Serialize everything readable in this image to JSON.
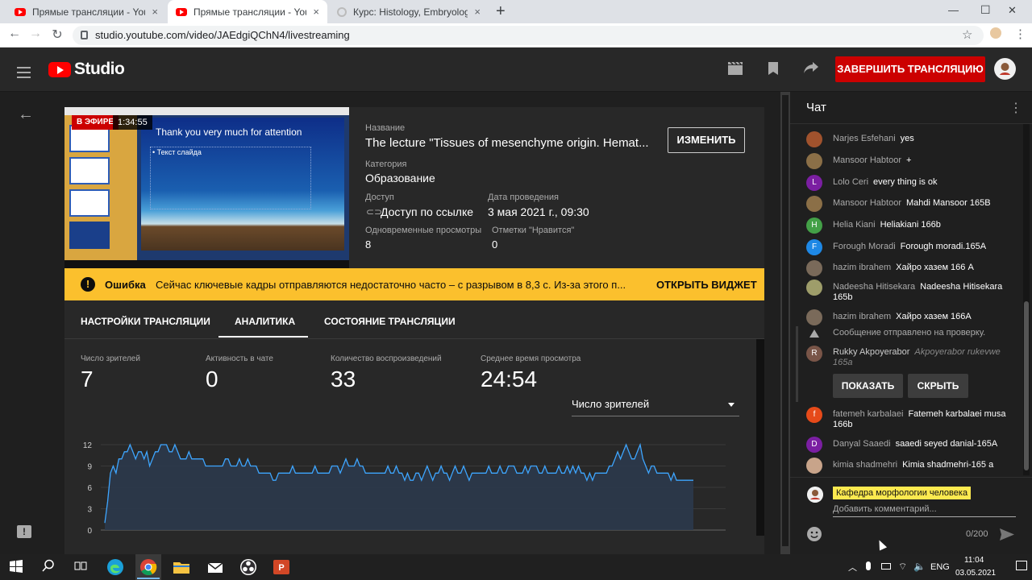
{
  "browser": {
    "tabs": [
      {
        "title": "Прямые трансляции - YouTube",
        "close": "×"
      },
      {
        "title": "Прямые трансляции - YouTube",
        "close": "×"
      },
      {
        "title": "Курс: Histology, Embryology, Cyt",
        "close": "×"
      }
    ],
    "new_tab": "+",
    "url": "studio.youtube.com/video/JAEdgiQChN4/livestreaming",
    "window": {
      "minimize": "—",
      "maximize": "☐",
      "close": "✕"
    }
  },
  "header": {
    "logo_text": "Studio",
    "end_stream": "ЗАВЕРШИТЬ ТРАНСЛЯЦИЮ"
  },
  "preview": {
    "live_badge": "В ЭФИРЕ",
    "timecode": "1:34:55",
    "slide_title": "Thank you very much for attention",
    "slide_bullet": "• Текст слайда"
  },
  "stream_info": {
    "name_label": "Название",
    "name_value": "The lecture \"Tissues of mesenchyme origin. Hemat...",
    "edit_button": "ИЗМЕНИТЬ",
    "category_label": "Категория",
    "category_value": "Образование",
    "access_label": "Доступ",
    "access_value": "Доступ по ссылке",
    "date_label": "Дата проведения",
    "date_value": "3 мая 2021 г., 09:30",
    "concurrent_label": "Одновременные просмотры",
    "concurrent_value": "8",
    "likes_label": "Отметки \"Нравится\"",
    "likes_value": "0"
  },
  "error_bar": {
    "title": "Ошибка",
    "message": "Сейчас ключевые кадры отправляются недостаточно часто – с разрывом в 8,3 с. Из-за этого п...",
    "action": "ОТКРЫТЬ ВИДЖЕТ",
    "color": "#fbc02d"
  },
  "tabs": [
    {
      "label": "НАСТРОЙКИ ТРАНСЛЯЦИИ"
    },
    {
      "label": "АНАЛИТИКА",
      "active": true
    },
    {
      "label": "СОСТОЯНИЕ ТРАНСЛЯЦИИ"
    }
  ],
  "analytics": {
    "metrics": [
      {
        "label": "Число зрителей",
        "value": "7"
      },
      {
        "label": "Активность в чате",
        "value": "0"
      },
      {
        "label": "Количество воспроизведений",
        "value": "33"
      },
      {
        "label": "Среднее время просмотра",
        "value": "24:54"
      }
    ],
    "dropdown": "Число зрителей"
  },
  "chart_data": {
    "type": "area",
    "ylim": [
      0,
      12
    ],
    "yticks": [
      "12",
      "9",
      "6",
      "3",
      "0"
    ],
    "values": [
      1,
      4,
      8,
      9,
      8,
      10,
      10,
      11,
      11,
      12,
      11,
      10,
      11,
      11,
      10,
      11,
      9,
      10,
      11,
      11,
      12,
      12,
      12,
      11,
      11,
      12,
      11,
      10,
      10,
      10,
      11,
      10,
      10,
      10,
      10,
      10,
      9,
      9,
      9,
      9,
      9,
      9,
      9,
      10,
      10,
      9,
      9,
      9,
      10,
      9,
      9,
      10,
      9,
      9,
      9,
      8,
      8,
      8,
      8,
      8,
      7,
      7,
      8,
      8,
      8,
      8,
      8,
      9,
      8,
      8,
      8,
      8,
      8,
      8,
      8,
      9,
      8,
      8,
      8,
      8,
      8,
      9,
      9,
      9,
      8,
      9,
      10,
      9,
      9,
      9,
      10,
      9,
      9,
      8,
      8,
      8,
      8,
      8,
      8,
      8,
      8,
      9,
      8,
      8,
      9,
      8,
      8,
      7,
      8,
      7,
      7,
      8,
      8,
      7,
      8,
      9,
      8,
      7,
      8,
      8,
      9,
      8,
      8,
      7,
      8,
      9,
      8,
      8,
      9,
      8,
      7,
      8,
      8,
      8,
      8,
      8,
      8,
      9,
      8,
      8,
      8,
      9,
      8,
      8,
      9,
      9,
      9,
      8,
      8,
      8,
      9,
      8,
      9,
      9,
      9,
      8,
      8,
      9,
      8,
      8,
      8,
      8,
      9,
      8,
      8,
      9,
      8,
      9,
      8,
      9,
      8,
      8,
      7,
      8,
      7,
      8,
      8,
      8,
      8,
      8,
      9,
      9,
      10,
      11,
      10,
      11,
      12,
      11,
      10,
      10,
      11,
      12,
      10,
      9,
      8,
      9,
      9,
      8,
      8,
      8,
      8,
      8,
      7,
      8,
      7,
      7,
      7,
      7,
      7,
      7,
      7
    ],
    "color": "#3ea6ff"
  },
  "chat": {
    "title": "Чат",
    "messages": [
      {
        "initial": "",
        "avatar_color": "#a0522d",
        "name": "Narjes Esfehani",
        "text": "yes"
      },
      {
        "initial": "",
        "avatar_color": "#8b6f47",
        "name": "Mansoor Habtoor",
        "text": "+"
      },
      {
        "initial": "L",
        "avatar_color": "#7b1fa2",
        "name": "Lolo Ceri",
        "text": "every thing is ok"
      },
      {
        "initial": "",
        "avatar_color": "#8b6f47",
        "name": "Mansoor Habtoor",
        "text": "Mahdi Mansoor 165B"
      },
      {
        "initial": "H",
        "avatar_color": "#43a047",
        "name": "Helia Kiani",
        "text": "Heliakiani 166b"
      },
      {
        "initial": "F",
        "avatar_color": "#1e88e5",
        "name": "Forough Moradi",
        "text": "Forough moradi.165A"
      },
      {
        "initial": "",
        "avatar_color": "#7a6a5a",
        "name": "hazim ibrahem",
        "text": "Хайро хазем 166 А"
      },
      {
        "initial": "",
        "avatar_color": "#9e9d6a",
        "name": "Nadeesha Hitisekara",
        "text": "Nadeesha Hitisekara 165b"
      },
      {
        "initial": "",
        "avatar_color": "#7a6a5a",
        "name": "hazim ibrahem",
        "text": "Хайро хазем 166А"
      }
    ],
    "review_note": "Сообщение отправлено на проверку.",
    "held": {
      "initial": "R",
      "avatar_color": "#795548",
      "name": "Rukky Akpoyerabor",
      "text": "Akpoyerabor rukevwe 165a",
      "show": "ПОКАЗАТЬ",
      "hide": "СКРЫТЬ"
    },
    "messages2": [
      {
        "initial": "f",
        "avatar_color": "#e64a19",
        "name": "fatemeh karbalaei",
        "text": "Fatemeh karbalaei musa 166b"
      },
      {
        "initial": "D",
        "avatar_color": "#7b1fa2",
        "name": "Danyal Saaedi",
        "text": "saaedi seyed danial-165A"
      },
      {
        "initial": "",
        "avatar_color": "#c8a48a",
        "name": "kimia shadmehri",
        "text": "Kimia shadmehri-165 a"
      }
    ],
    "composer": {
      "channel": "Кафедра морфологии человека",
      "placeholder": "Добавить комментарий...",
      "counter": "0/200"
    }
  },
  "taskbar": {
    "lang": "ENG",
    "time": "11:04",
    "date": "03.05.2021"
  }
}
